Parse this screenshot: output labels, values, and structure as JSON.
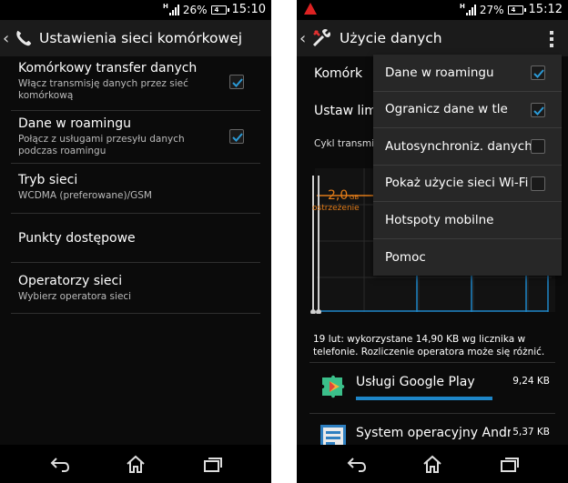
{
  "left": {
    "status": {
      "network": "H",
      "battery": "26%",
      "battery_inner": "4",
      "time": "15:10"
    },
    "title": "Ustawienia sieci komórkowej",
    "rows": [
      {
        "title": "Komórkowy transfer danych",
        "subtitle": "Włącz transmisję danych przez sieć komórkową",
        "checked": true
      },
      {
        "title": "Dane w roamingu",
        "subtitle": "Połącz z usługami przesyłu danych podczas roamingu",
        "checked": true
      },
      {
        "title": "Tryb sieci",
        "subtitle": "WCDMA (preferowane)/GSM"
      },
      {
        "title": "Punkty dostępowe"
      },
      {
        "title": "Operatorzy sieci",
        "subtitle": "Wybierz operatora sieci"
      }
    ]
  },
  "right": {
    "status": {
      "network": "H",
      "battery": "27%",
      "battery_inner": "4",
      "time": "15:12"
    },
    "title": "Użycie danych",
    "partial_rows": [
      "Komórk",
      "Ustaw lim"
    ],
    "cycle_label": "Cykl transmis",
    "chart": {
      "warning_value": "2,0",
      "warning_unit": "GB",
      "warning_label": "ostrzeżenie"
    },
    "usage_note": "19 lut: wykorzystane 14,90 KB wg licznika w telefonie. Rozliczenie operatora może się różnić.",
    "apps": [
      {
        "name": "Usługi Google Play",
        "size": "9,24 KB",
        "fraction": 1.0
      },
      {
        "name": "System operacyjny Andro",
        "size": "5,37 KB",
        "fraction": 0.58
      }
    ],
    "menu": [
      {
        "label": "Dane w roamingu",
        "checkbox": true,
        "checked": true
      },
      {
        "label": "Ogranicz dane w tle",
        "checkbox": true,
        "checked": true
      },
      {
        "label": "Autosynchroniz. danych",
        "checkbox": true,
        "checked": false
      },
      {
        "label": "Pokaż użycie sieci Wi-Fi",
        "checkbox": true,
        "checked": false
      },
      {
        "label": "Hotspoty mobilne",
        "checkbox": false
      },
      {
        "label": "Pomoc",
        "checkbox": false
      }
    ]
  },
  "colors": {
    "accent": "#1e86c8",
    "warning": "#e07b19",
    "alert": "#dd2222"
  }
}
